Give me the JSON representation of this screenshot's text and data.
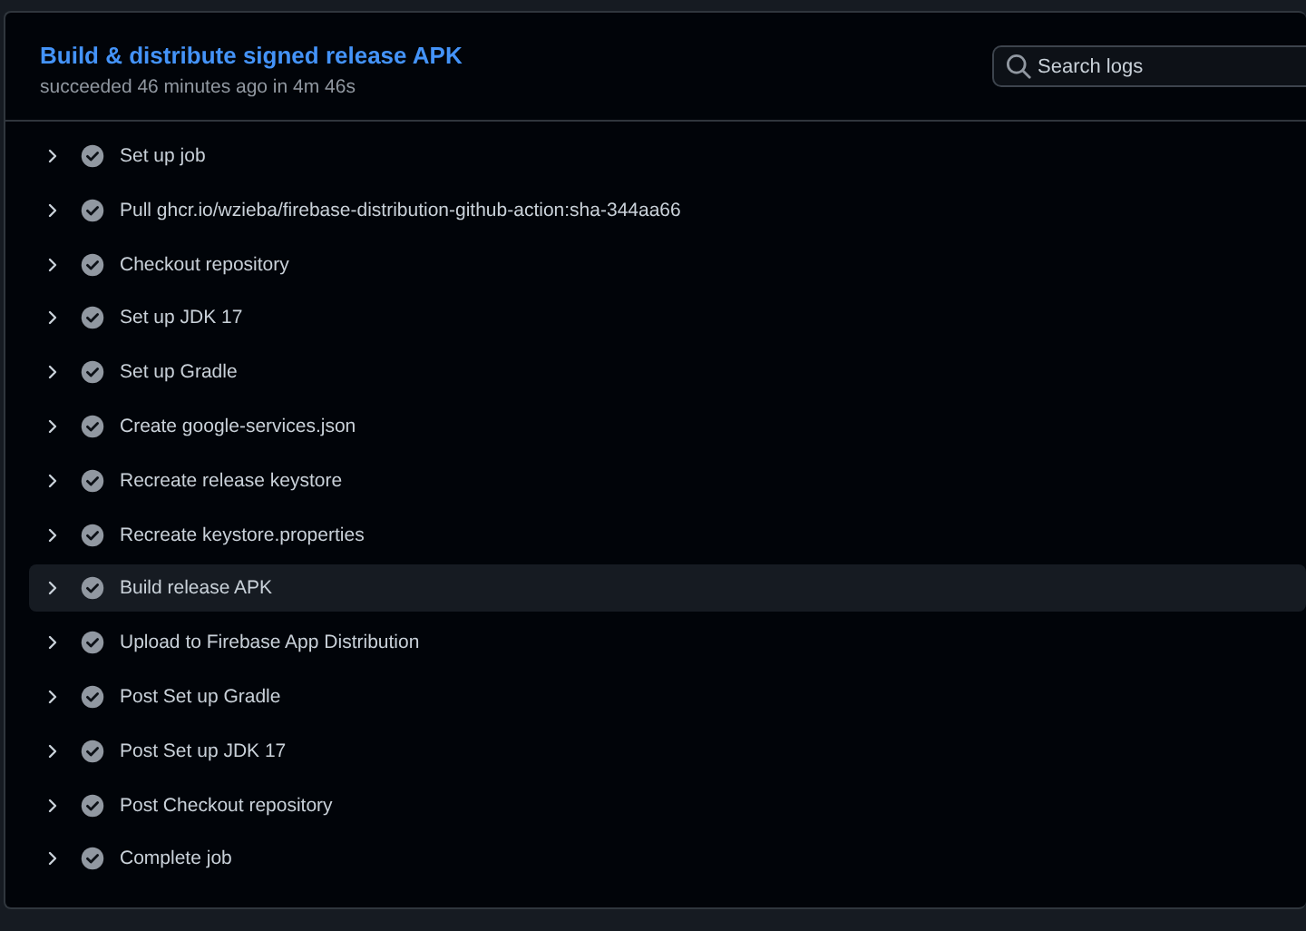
{
  "job": {
    "title": "Build & distribute signed release APK",
    "summary": "succeeded 46 minutes ago in 4m 46s"
  },
  "search": {
    "placeholder": "Search logs"
  },
  "steps": [
    {
      "label": "Set up job",
      "kind": "success",
      "expanded": false,
      "selected": false
    },
    {
      "label": "Pull ghcr.io/wzieba/firebase-distribution-github-action:sha-344aa66",
      "kind": "success",
      "expanded": false,
      "selected": false
    },
    {
      "label": "Checkout repository",
      "kind": "success",
      "expanded": false,
      "selected": false
    },
    {
      "label": "Set up JDK 17",
      "kind": "success",
      "expanded": false,
      "selected": false
    },
    {
      "label": "Set up Gradle",
      "kind": "success",
      "expanded": false,
      "selected": false
    },
    {
      "label": "Create google-services.json",
      "kind": "success",
      "expanded": false,
      "selected": false
    },
    {
      "label": "Recreate release keystore",
      "kind": "success",
      "expanded": false,
      "selected": false
    },
    {
      "label": "Recreate keystore.properties",
      "kind": "success",
      "expanded": false,
      "selected": false
    },
    {
      "label": "Build release APK",
      "kind": "success",
      "expanded": false,
      "selected": true
    },
    {
      "label": "Upload to Firebase App Distribution",
      "kind": "success",
      "expanded": false,
      "selected": false
    },
    {
      "label": "Post Set up Gradle",
      "kind": "success",
      "expanded": false,
      "selected": false
    },
    {
      "label": "Post Set up JDK 17",
      "kind": "success",
      "expanded": false,
      "selected": false
    },
    {
      "label": "Post Checkout repository",
      "kind": "success",
      "expanded": false,
      "selected": false
    },
    {
      "label": "Complete job",
      "kind": "success",
      "expanded": false,
      "selected": false
    }
  ]
}
